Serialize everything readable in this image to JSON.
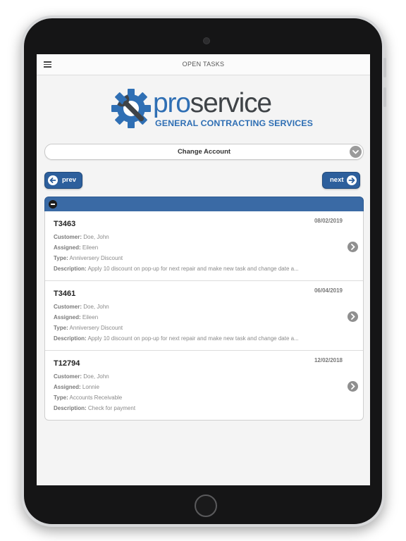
{
  "header": {
    "title": "OPEN TASKS",
    "menu_icon": "hamburger-menu-icon"
  },
  "logo": {
    "word_pro": "pro",
    "word_service": "service",
    "tagline": "GENERAL CONTRACTING SERVICES",
    "gear_icon": "gear-wrench-icon",
    "colors": {
      "blue": "#2f6fb4",
      "dark": "#3f4347"
    }
  },
  "account": {
    "label": "Change Account",
    "icon": "chevron-down-icon"
  },
  "nav": {
    "prev_label": "prev",
    "next_label": "next"
  },
  "colors": {
    "accent": "#3a6aa5",
    "button": "#2d5f9c"
  },
  "field_labels": {
    "customer": "Customer:",
    "assigned": "Assigned:",
    "type": "Type:",
    "description": "Description:"
  },
  "tasks": [
    {
      "id": "T3463",
      "date": "08/02/2019",
      "customer": "Doe, John",
      "assigned": "Eileen",
      "type": "Anniversery Discount",
      "description": "Apply 10 discount on pop-up for next repair and make new task and change date a..."
    },
    {
      "id": "T3461",
      "date": "06/04/2019",
      "customer": "Doe, John",
      "assigned": "Eileen",
      "type": "Anniversery Discount",
      "description": "Apply 10 discount on pop-up for next repair and make new task and change date a..."
    },
    {
      "id": "T12794",
      "date": "12/02/2018",
      "customer": "Doe, John",
      "assigned": "Lonnie",
      "type": "Accounts Receivable",
      "description": "Check for payment"
    }
  ]
}
